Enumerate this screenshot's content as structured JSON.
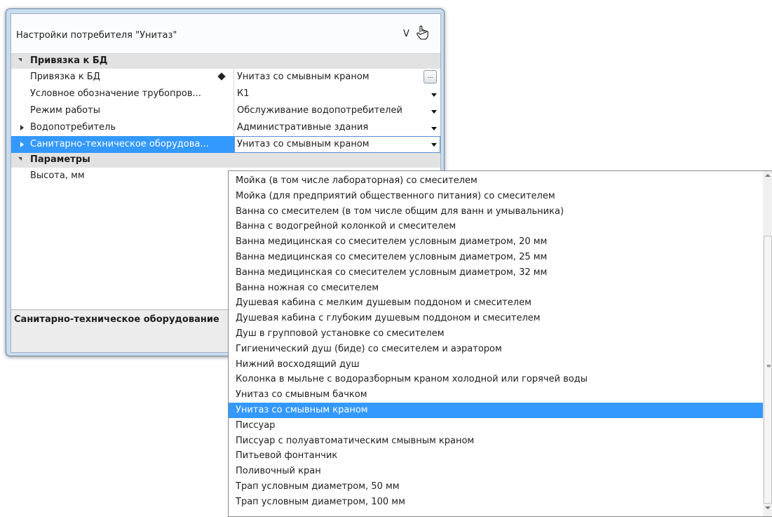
{
  "window": {
    "title": "Настройки потребителя \"Унитаз\"",
    "title_v": "V"
  },
  "grid": {
    "categories": {
      "db_binding": "Привязка к БД",
      "parameters": "Параметры"
    },
    "rows": [
      {
        "name": "Привязка к БД",
        "value": "Унитаз со смывным краном"
      },
      {
        "name": "Условное обозначение трубопров...",
        "value": "К1"
      },
      {
        "name": "Режим работы",
        "value": "Обслуживание водопотребителей"
      },
      {
        "name": "Водопотребитель",
        "value": "Административные здания"
      },
      {
        "name": "Санитарно-техническое оборудова...",
        "value": "Унитаз со смывным краном"
      }
    ],
    "height_row": {
      "name": "Высота, мм",
      "value": ""
    }
  },
  "description": "Санитарно-техническое оборудование",
  "dropdown": {
    "selected_index": 15,
    "options": [
      "Мойка (в том числе лабораторная) со смесителем",
      "Мойка (для предприятий общественного питания) со смесителем",
      "Ванна со смесителем (в том числе общим для ванн и умывальника)",
      "Ванна с водогрейной колонкой и смесителем",
      "Ванна медицинская со смесителем условным диаметром, 20 мм",
      "Ванна медицинская со смесителем условным диаметром, 25 мм",
      "Ванна медицинская со смесителем условным диаметром, 32 мм",
      "Ванна ножная со смесителем",
      "Душевая кабина с мелким душевым поддоном и смесителем",
      "Душевая кабина с глубоким душевым поддоном и смесителем",
      "Душ в групповой установке со смесителем",
      "Гигиенический душ (биде) со смесителем и аэратором",
      "Нижний восходящий душ",
      "Колонка в мыльне с водоразборным краном холодной или горячей воды",
      "Унитаз со смывным бачком",
      "Унитаз со смывным краном",
      "Писсуар",
      "Писсуар с полуавтоматическим смывным краном",
      "Питьевой фонтанчик",
      "Поливочный кран",
      "Трап условным диаметром, 50 мм",
      "Трап условным диаметром, 100 мм"
    ]
  },
  "colors": {
    "selection": "#3399ff",
    "category_bg": "#e2e2e2",
    "window_frame": "#c9dcee"
  },
  "icons": [
    "hand-cursor-icon",
    "diamond-icon",
    "ellipsis-icon",
    "dropdown-arrow-icon",
    "expand-arrow-icon",
    "collapse-arrow-icon"
  ]
}
